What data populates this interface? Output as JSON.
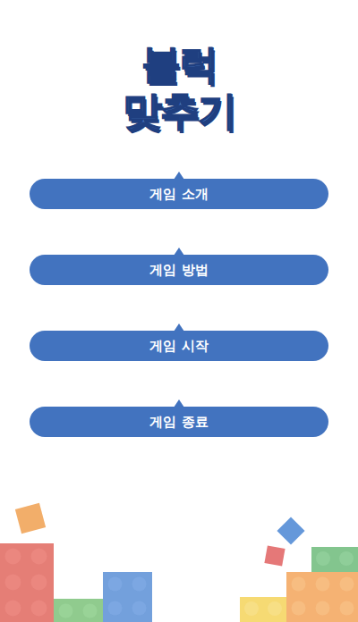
{
  "title": {
    "lines": [
      "블럭",
      "맞추기"
    ]
  },
  "menu": [
    {
      "label": "게임 소개"
    },
    {
      "label": "게임 방법"
    },
    {
      "label": "게임 시작"
    },
    {
      "label": "게임 종료"
    }
  ]
}
